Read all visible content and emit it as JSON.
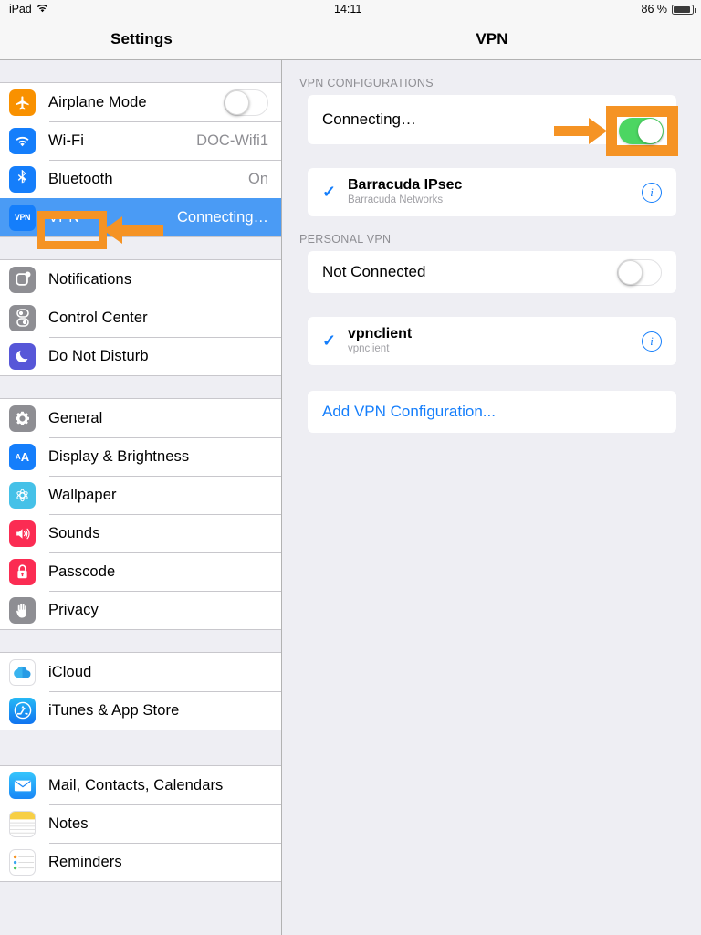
{
  "statusbar": {
    "device": "iPad",
    "wifi_icon": "wifi-icon",
    "time": "14:11",
    "battery_percent": "86 %",
    "battery_icon": "battery-icon"
  },
  "sidebar": {
    "title": "Settings",
    "groups": [
      {
        "items": [
          {
            "label": "Airplane Mode",
            "icon": "airplane-icon",
            "control": "toggle",
            "toggle_on": false,
            "value": ""
          },
          {
            "label": "Wi-Fi",
            "icon": "wifi-icon",
            "control": "value",
            "value": "DOC-Wifi1"
          },
          {
            "label": "Bluetooth",
            "icon": "bluetooth-icon",
            "control": "value",
            "value": "On"
          },
          {
            "label": "VPN",
            "icon": "vpn-icon",
            "control": "value",
            "value": "Connecting…",
            "selected": true
          }
        ]
      },
      {
        "items": [
          {
            "label": "Notifications",
            "icon": "notifications-icon",
            "control": "none",
            "value": ""
          },
          {
            "label": "Control Center",
            "icon": "control-center-icon",
            "control": "none",
            "value": ""
          },
          {
            "label": "Do Not Disturb",
            "icon": "moon-icon",
            "control": "none",
            "value": ""
          }
        ]
      },
      {
        "items": [
          {
            "label": "General",
            "icon": "gear-icon",
            "control": "none",
            "value": ""
          },
          {
            "label": "Display & Brightness",
            "icon": "display-brightness-icon",
            "control": "none",
            "value": ""
          },
          {
            "label": "Wallpaper",
            "icon": "wallpaper-icon",
            "control": "none",
            "value": ""
          },
          {
            "label": "Sounds",
            "icon": "speaker-icon",
            "control": "none",
            "value": ""
          },
          {
            "label": "Passcode",
            "icon": "lock-icon",
            "control": "none",
            "value": ""
          },
          {
            "label": "Privacy",
            "icon": "hand-icon",
            "control": "none",
            "value": ""
          }
        ]
      },
      {
        "items": [
          {
            "label": "iCloud",
            "icon": "icloud-icon",
            "control": "none",
            "value": ""
          },
          {
            "label": "iTunes & App Store",
            "icon": "app-store-icon",
            "control": "none",
            "value": ""
          }
        ]
      },
      {
        "items": [
          {
            "label": "Mail, Contacts, Calendars",
            "icon": "mail-icon",
            "control": "none",
            "value": ""
          },
          {
            "label": "Notes",
            "icon": "notes-icon",
            "control": "none",
            "value": ""
          },
          {
            "label": "Reminders",
            "icon": "reminders-icon",
            "control": "none",
            "value": ""
          }
        ]
      }
    ]
  },
  "detail": {
    "title": "VPN",
    "sections": [
      {
        "header": "VPN CONFIGURATIONS",
        "status_row": {
          "label": "Connecting…",
          "toggle_on": true
        },
        "config": {
          "name": "Barracuda IPsec",
          "subtitle": "Barracuda Networks",
          "checked": true,
          "info": "i"
        }
      },
      {
        "header": "PERSONAL VPN",
        "status_row": {
          "label": "Not Connected",
          "toggle_on": false
        },
        "config": {
          "name": "vpnclient",
          "subtitle": "vpnclient",
          "checked": true,
          "info": "i"
        }
      }
    ],
    "add_config_label": "Add VPN Configuration..."
  },
  "annotations": {
    "color": "#f59324",
    "items": [
      {
        "name": "vpn-sidebar-highlight",
        "type": "box-with-left-arrow"
      },
      {
        "name": "vpn-toggle-highlight",
        "type": "box-with-left-arrow"
      }
    ]
  }
}
